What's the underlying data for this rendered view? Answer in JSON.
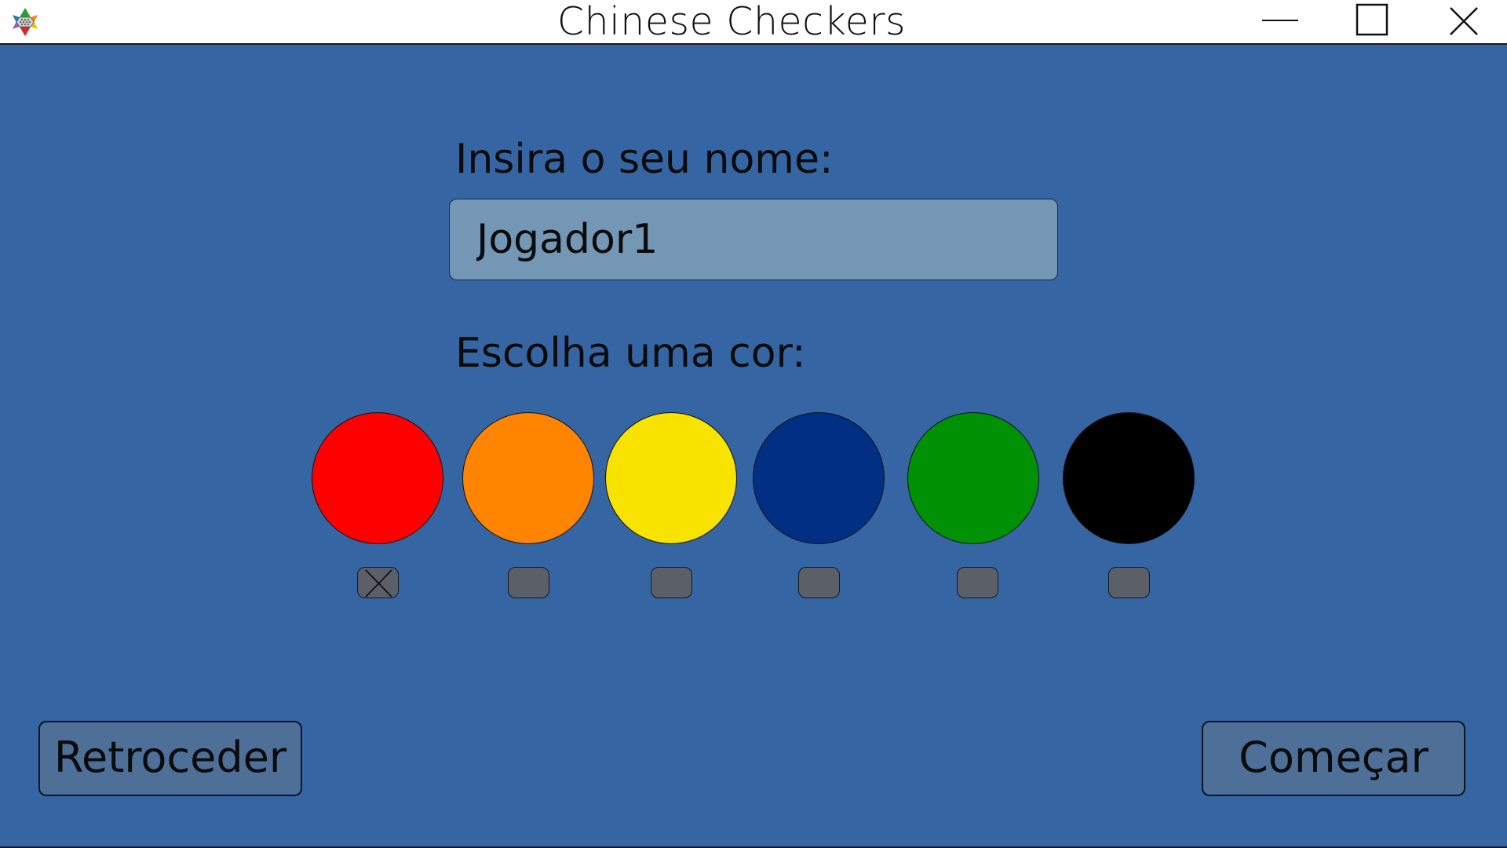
{
  "window": {
    "title": "Chinese Checkers",
    "app_icon": "star-board-icon",
    "controls": {
      "minimize_icon": "minimize-icon",
      "maximize_icon": "maximize-icon",
      "close_icon": "close-icon"
    }
  },
  "form": {
    "name_label": "Insira o seu nome:",
    "name_value": "Jogador1",
    "color_label": "Escolha uma cor:",
    "colors": [
      {
        "name": "red",
        "hex": "#ff0000",
        "checked": true
      },
      {
        "name": "orange",
        "hex": "#ff8400",
        "checked": false
      },
      {
        "name": "yellow",
        "hex": "#f7e200",
        "checked": false
      },
      {
        "name": "dark-blue",
        "hex": "#012f83",
        "checked": false
      },
      {
        "name": "green",
        "hex": "#009104",
        "checked": false
      },
      {
        "name": "black",
        "hex": "#000000",
        "checked": false
      }
    ]
  },
  "buttons": {
    "back_label": "Retroceder",
    "start_label": "Começar"
  },
  "theme": {
    "background": "#3565a3",
    "input_background": "#7397b4",
    "button_background": "#4d6f98",
    "checkbox_background": "#5b5f67"
  }
}
